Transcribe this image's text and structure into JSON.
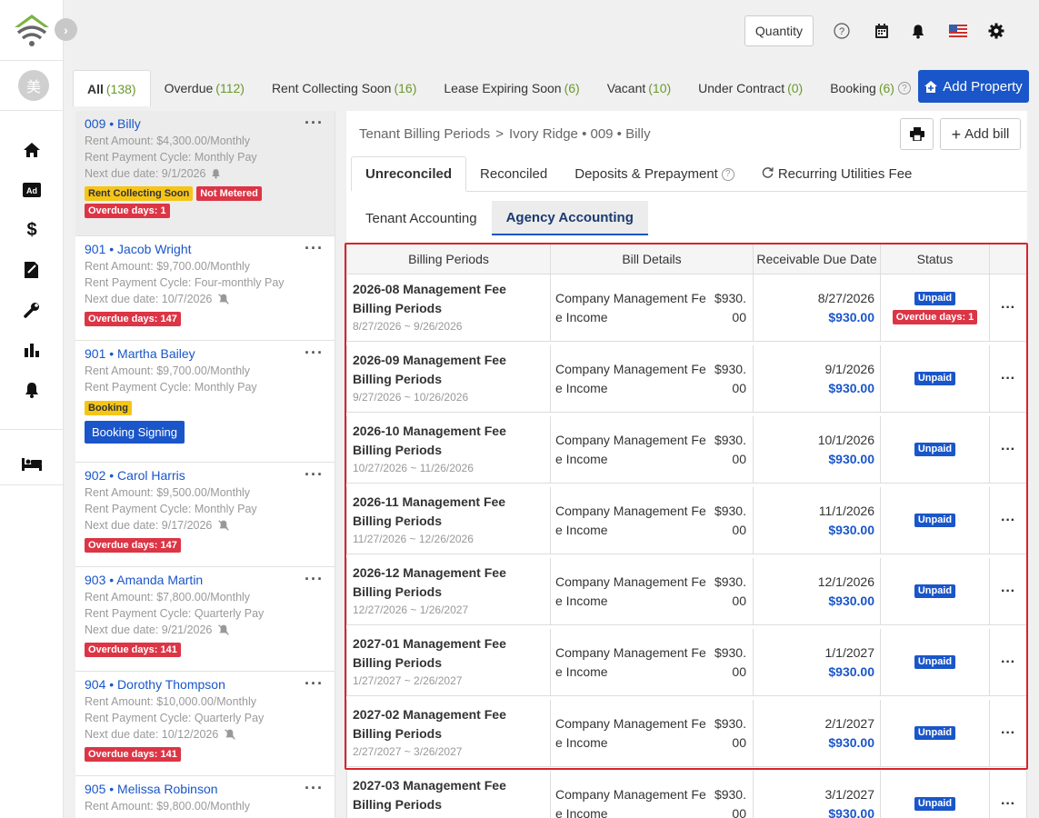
{
  "rail": {
    "avatar_text": "美",
    "nav_icons": [
      "home-icon",
      "ad-icon",
      "dollar-icon",
      "contract-icon",
      "wrench-icon",
      "chart-icon",
      "bell-icon",
      "bed-icon"
    ]
  },
  "topbar": {
    "quantity_label": "Quantity"
  },
  "filter_tabs": [
    {
      "label": "All",
      "count": "(138)"
    },
    {
      "label": "Overdue",
      "count": "(112)"
    },
    {
      "label": "Rent Collecting Soon",
      "count": "(16)"
    },
    {
      "label": "Lease Expiring Soon",
      "count": "(6)"
    },
    {
      "label": "Vacant",
      "count": "(10)"
    },
    {
      "label": "Under Contract",
      "count": "(0)"
    },
    {
      "label": "Booking",
      "count": "(6)"
    }
  ],
  "add_property_label": "Add Property",
  "properties": [
    {
      "unit": "009",
      "name": "Billy",
      "rent": "Rent Amount: $4,300.00/Monthly",
      "cycle": "Rent Payment Cycle: Monthly Pay",
      "next_due": "Next due date:  9/1/2026",
      "badge1": "Rent Collecting Soon",
      "badge2": "Not Metered",
      "overdue": "Overdue days: 1"
    },
    {
      "unit": "901",
      "name": "Jacob Wright",
      "rent": "Rent Amount: $9,700.00/Monthly",
      "cycle": "Rent Payment Cycle: Four-monthly Pay",
      "next_due": "Next due date:  10/7/2026",
      "overdue": "Overdue days: 147"
    },
    {
      "unit": "901",
      "name": "Martha Bailey",
      "rent": "Rent Amount: $9,700.00/Monthly",
      "cycle": "Rent Payment Cycle: Monthly Pay",
      "badge1": "Booking",
      "action": "Booking Signing"
    },
    {
      "unit": "902",
      "name": "Carol Harris",
      "rent": "Rent Amount: $9,500.00/Monthly",
      "cycle": "Rent Payment Cycle: Monthly Pay",
      "next_due": "Next due date:  9/17/2026",
      "overdue": "Overdue days: 147"
    },
    {
      "unit": "903",
      "name": "Amanda Martin",
      "rent": "Rent Amount: $7,800.00/Monthly",
      "cycle": "Rent Payment Cycle: Quarterly Pay",
      "next_due": "Next due date:  9/21/2026",
      "overdue": "Overdue days: 141"
    },
    {
      "unit": "904",
      "name": "Dorothy Thompson",
      "rent": "Rent Amount: $10,000.00/Monthly",
      "cycle": "Rent Payment Cycle: Quarterly Pay",
      "next_due": "Next due date:  10/12/2026",
      "overdue": "Overdue days: 141"
    },
    {
      "unit": "905",
      "name": "Melissa Robinson",
      "rent": "Rent Amount: $9,800.00/Monthly"
    }
  ],
  "detail": {
    "crumb_root": "Tenant Billing Periods",
    "crumb_sep": ">",
    "crumb_prop": "Ivory Ridge • 009 • Billy",
    "add_bill_label": "Add bill",
    "tabs": [
      "Unreconciled",
      "Reconciled",
      "Deposits & Prepayment",
      "Recurring Utilities Fee"
    ],
    "subtabs": [
      "Tenant Accounting",
      "Agency Accounting"
    ],
    "headers": [
      "Billing Periods",
      "Bill Details",
      "Receivable Due Date",
      "Status"
    ],
    "rows": [
      {
        "title": "2026-08 Management Fee Billing Periods",
        "range": "8/27/2026 ~ 9/26/2026",
        "name": "Company Management Fee Income",
        "amount": "$930.00",
        "due": "8/27/2026",
        "due_amount": "$930.00",
        "status": "Unpaid",
        "overdue": "Overdue days: 1"
      },
      {
        "title": "2026-09 Management Fee Billing Periods",
        "range": "9/27/2026 ~ 10/26/2026",
        "name": "Company Management Fee Income",
        "amount": "$930.00",
        "due": "9/1/2026",
        "due_amount": "$930.00",
        "status": "Unpaid"
      },
      {
        "title": "2026-10 Management Fee Billing Periods",
        "range": "10/27/2026 ~ 11/26/2026",
        "name": "Company Management Fee Income",
        "amount": "$930.00",
        "due": "10/1/2026",
        "due_amount": "$930.00",
        "status": "Unpaid"
      },
      {
        "title": "2026-11 Management Fee Billing Periods",
        "range": "11/27/2026 ~ 12/26/2026",
        "name": "Company Management Fee Income",
        "amount": "$930.00",
        "due": "11/1/2026",
        "due_amount": "$930.00",
        "status": "Unpaid"
      },
      {
        "title": "2026-12 Management Fee Billing Periods",
        "range": "12/27/2026 ~ 1/26/2027",
        "name": "Company Management Fee Income",
        "amount": "$930.00",
        "due": "12/1/2026",
        "due_amount": "$930.00",
        "status": "Unpaid"
      },
      {
        "title": "2027-01 Management Fee Billing Periods",
        "range": "1/27/2027 ~ 2/26/2027",
        "name": "Company Management Fee Income",
        "amount": "$930.00",
        "due": "1/1/2027",
        "due_amount": "$930.00",
        "status": "Unpaid"
      },
      {
        "title": "2027-02 Management Fee Billing Periods",
        "range": "2/27/2027 ~ 3/26/2027",
        "name": "Company Management Fee Income",
        "amount": "$930.00",
        "due": "2/1/2027",
        "due_amount": "$930.00",
        "status": "Unpaid"
      },
      {
        "title": "2027-03 Management Fee Billing Periods",
        "range": "",
        "name": "Company Management Fee Income",
        "amount": "$930.00",
        "due": "3/1/2027",
        "due_amount": "$930.00",
        "status": "Unpaid"
      }
    ]
  },
  "colors": {
    "accent": "#1a56c9",
    "count_green": "#6a9a2a",
    "danger": "#dc3545",
    "warning": "#f5c518",
    "highlight_border": "#d9232d"
  }
}
